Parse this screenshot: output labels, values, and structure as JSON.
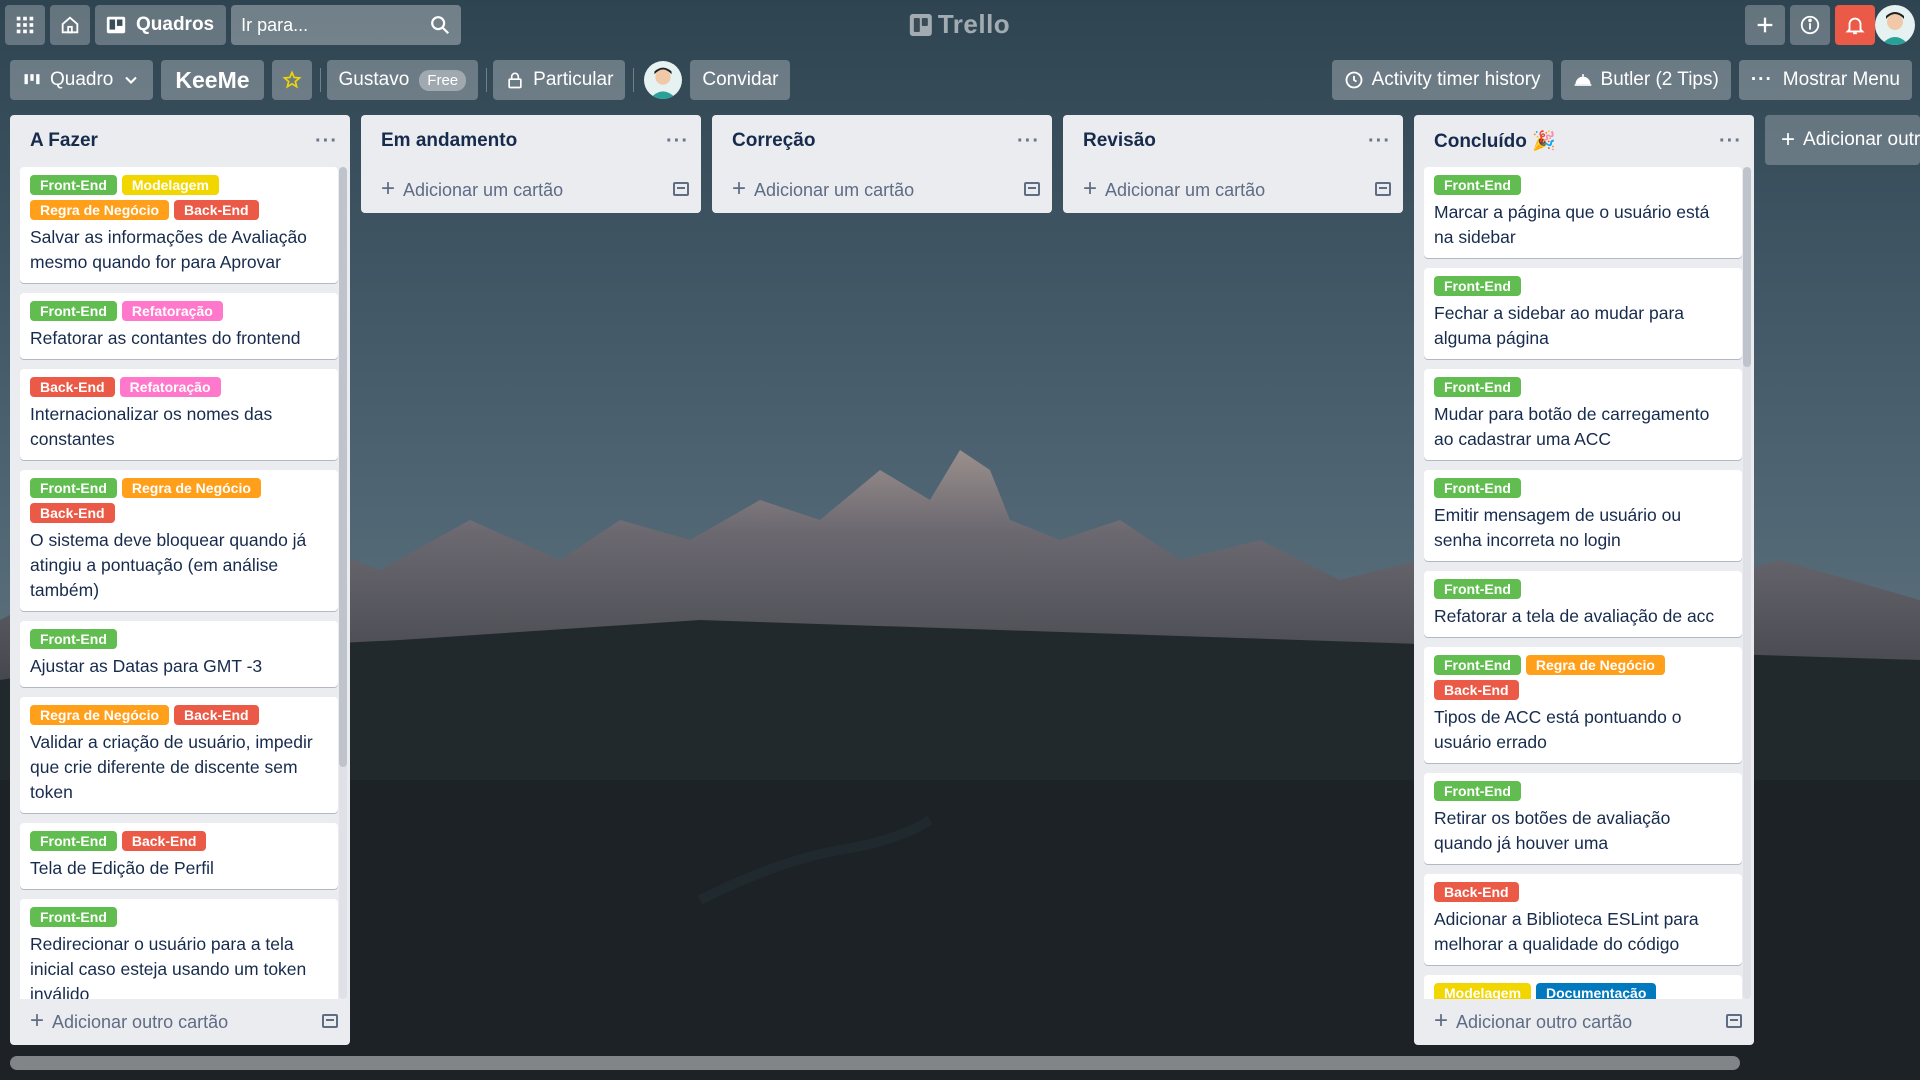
{
  "header": {
    "boards_label": "Quadros",
    "search_placeholder": "Ir para...",
    "logo_text": "Trello"
  },
  "board_header": {
    "view_label": "Quadro",
    "board_name": "KeeMe",
    "team_name": "Gustavo",
    "team_badge": "Free",
    "visibility_label": "Particular",
    "invite_label": "Convidar",
    "activity_label": "Activity timer history",
    "butler_label": "Butler (2 Tips)",
    "menu_label": "Mostrar Menu"
  },
  "colors": {
    "green": "#61bd4f",
    "yellow": "#f2d600",
    "orange": "#ff9f1a",
    "red": "#eb5a46",
    "pink": "#ff78cb",
    "blue": "#0079bf"
  },
  "lists": [
    {
      "title": "A Fazer",
      "menu": "···",
      "add_label": "Adicionar outro cartão",
      "cards": [
        {
          "labels": [
            {
              "text": "Front-End",
              "color": "green"
            },
            {
              "text": "Modelagem",
              "color": "yellow"
            },
            {
              "text": "Regra de Negócio",
              "color": "orange"
            },
            {
              "text": "Back-End",
              "color": "red"
            }
          ],
          "title": "Salvar as informações de Avaliação mesmo quando for para Aprovar"
        },
        {
          "labels": [
            {
              "text": "Front-End",
              "color": "green"
            },
            {
              "text": "Refatoração",
              "color": "pink"
            }
          ],
          "title": "Refatorar as contantes do frontend"
        },
        {
          "labels": [
            {
              "text": "Back-End",
              "color": "red"
            },
            {
              "text": "Refatoração",
              "color": "pink"
            }
          ],
          "title": "Internacionalizar os nomes das constantes"
        },
        {
          "labels": [
            {
              "text": "Front-End",
              "color": "green"
            },
            {
              "text": "Regra de Negócio",
              "color": "orange"
            },
            {
              "text": "Back-End",
              "color": "red"
            }
          ],
          "title": "O sistema deve bloquear quando já atingiu a pontuação (em análise também)"
        },
        {
          "labels": [
            {
              "text": "Front-End",
              "color": "green"
            }
          ],
          "title": "Ajustar as Datas para GMT -3"
        },
        {
          "labels": [
            {
              "text": "Regra de Negócio",
              "color": "orange"
            },
            {
              "text": "Back-End",
              "color": "red"
            }
          ],
          "title": "Validar a criação de usuário, impedir que crie diferente de discente sem token"
        },
        {
          "labels": [
            {
              "text": "Front-End",
              "color": "green"
            },
            {
              "text": "Back-End",
              "color": "red"
            }
          ],
          "title": "Tela de Edição de Perfil"
        },
        {
          "labels": [
            {
              "text": "Front-End",
              "color": "green"
            }
          ],
          "title": "Redirecionar o usuário para a tela inicial caso esteja usando um token inválido"
        }
      ]
    },
    {
      "title": "Em andamento",
      "menu": "···",
      "add_label": "Adicionar um cartão",
      "cards": []
    },
    {
      "title": "Correção",
      "menu": "···",
      "add_label": "Adicionar um cartão",
      "cards": []
    },
    {
      "title": "Revisão",
      "menu": "···",
      "add_label": "Adicionar um cartão",
      "cards": []
    },
    {
      "title": "Concluído 🎉",
      "menu": "···",
      "add_label": "Adicionar outro cartão",
      "cards": [
        {
          "labels": [
            {
              "text": "Front-End",
              "color": "green"
            }
          ],
          "title": "Marcar a página que o usuário está na sidebar"
        },
        {
          "labels": [
            {
              "text": "Front-End",
              "color": "green"
            }
          ],
          "title": "Fechar a sidebar ao mudar para alguma página"
        },
        {
          "labels": [
            {
              "text": "Front-End",
              "color": "green"
            }
          ],
          "title": "Mudar para botão de carregamento ao cadastrar uma ACC"
        },
        {
          "labels": [
            {
              "text": "Front-End",
              "color": "green"
            }
          ],
          "title": "Emitir mensagem de usuário ou senha incorreta no login"
        },
        {
          "labels": [
            {
              "text": "Front-End",
              "color": "green"
            }
          ],
          "title": "Refatorar a tela de avaliação de acc"
        },
        {
          "labels": [
            {
              "text": "Front-End",
              "color": "green"
            },
            {
              "text": "Regra de Negócio",
              "color": "orange"
            },
            {
              "text": "Back-End",
              "color": "red"
            }
          ],
          "title": "Tipos de ACC está pontuando o usuário errado"
        },
        {
          "labels": [
            {
              "text": "Front-End",
              "color": "green"
            }
          ],
          "title": "Retirar os botões de avaliação quando já houver uma"
        },
        {
          "labels": [
            {
              "text": "Back-End",
              "color": "red"
            }
          ],
          "title": "Adicionar a Biblioteca ESLint para melhorar a qualidade do código"
        },
        {
          "labels": [
            {
              "text": "Modelagem",
              "color": "yellow"
            },
            {
              "text": "Documentação",
              "color": "blue"
            }
          ],
          "title": ""
        }
      ]
    }
  ],
  "add_list_label": "Adicionar outra lista"
}
